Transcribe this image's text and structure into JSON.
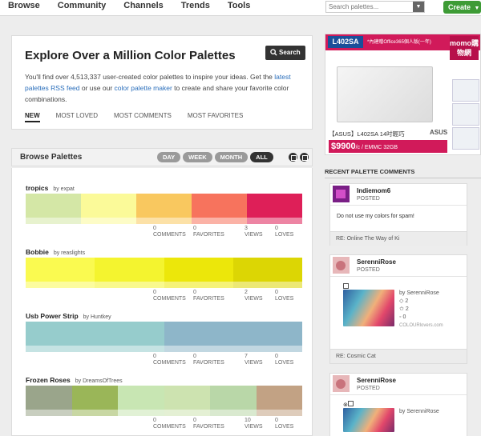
{
  "nav": {
    "items": [
      "Browse",
      "Community",
      "Channels",
      "Trends",
      "Tools"
    ],
    "search_placeholder": "Search palettes...",
    "create_label": "Create"
  },
  "hero": {
    "title": "Explore Over a Million Color Palettes",
    "search_label": "Search",
    "text_1": "You'll find over 4,513,337 user-created color palettes to inspire your ideas. Get the ",
    "link_1": "latest palettes RSS feed",
    "text_2": " or use our ",
    "link_2": "color palette maker",
    "text_3": " to create and share your favorite color combinations.",
    "tabs": [
      "NEW",
      "MOST LOVED",
      "MOST COMMENTS",
      "MOST FAVORITES"
    ]
  },
  "browse": {
    "title": "Browse Palettes",
    "filters": [
      "DAY",
      "WEEK",
      "MONTH",
      "ALL"
    ],
    "active_filter": "ALL"
  },
  "stat_labels": [
    "COMMENTS",
    "FAVORITES",
    "VIEWS",
    "LOVES"
  ],
  "palettes": [
    {
      "name": "tropics",
      "by": "by expat",
      "colors": [
        "#d4e7a6",
        "#fbfa99",
        "#f9c85f",
        "#f7735d",
        "#de1f58"
      ],
      "weights": [
        1,
        1,
        1,
        1,
        1
      ],
      "stats": [
        "0",
        "0",
        "3",
        "0"
      ]
    },
    {
      "name": "Bobbie",
      "by": "by reaslights",
      "colors": [
        "#fafa50",
        "#f4f42f",
        "#ece70a",
        "#dcd604"
      ],
      "weights": [
        1,
        1,
        1,
        1
      ],
      "stats": [
        "0",
        "0",
        "2",
        "0"
      ]
    },
    {
      "name": "Usb Power Strip",
      "by": "by Huntkey",
      "colors": [
        "#96cccc",
        "#8eb6c9"
      ],
      "weights": [
        1,
        1
      ],
      "stats": [
        "0",
        "0",
        "7",
        "0"
      ]
    },
    {
      "name": "Frozen Roses",
      "by": "by DreamsOfTrees",
      "colors": [
        "#9aa58b",
        "#9ab658",
        "#c8e6b3",
        "#cde3b0",
        "#b9d7a8",
        "#c2a284"
      ],
      "weights": [
        1,
        1,
        1,
        1,
        1,
        1
      ],
      "stats": [
        "0",
        "0",
        "10",
        "0"
      ]
    }
  ],
  "ad": {
    "model": "L402SA",
    "tag": "*內建贈Office365個人版(一年)",
    "brand": "momo購物網",
    "caption": "【ASUS】L402SA 14吋輕巧",
    "price": "$9900",
    "price_suffix": "/c / EMMC 32GB",
    "sub_brand": "ASUS"
  },
  "recent": {
    "title": "RECENT PALETTE COMMENTS",
    "comments": [
      {
        "user": "Indiemom6",
        "posted": "POSTED",
        "body": "Do not use my colors for spam!",
        "re": "RE: Online The Way of Ki"
      },
      {
        "user": "SerenniRose",
        "posted": "POSTED",
        "by": "by SerenniRose",
        "counts": [
          "2",
          "2",
          "0"
        ],
        "site": "COLOURlovers.com",
        "re": "RE: Cosmic Cat"
      },
      {
        "user": "SerenniRose",
        "posted": "POSTED",
        "by": "by SerenniRose"
      }
    ]
  },
  "colors": {
    "accent_green": "#3d9b35",
    "ad_pink": "#d11a5a",
    "link_blue": "#2a6ebb"
  }
}
